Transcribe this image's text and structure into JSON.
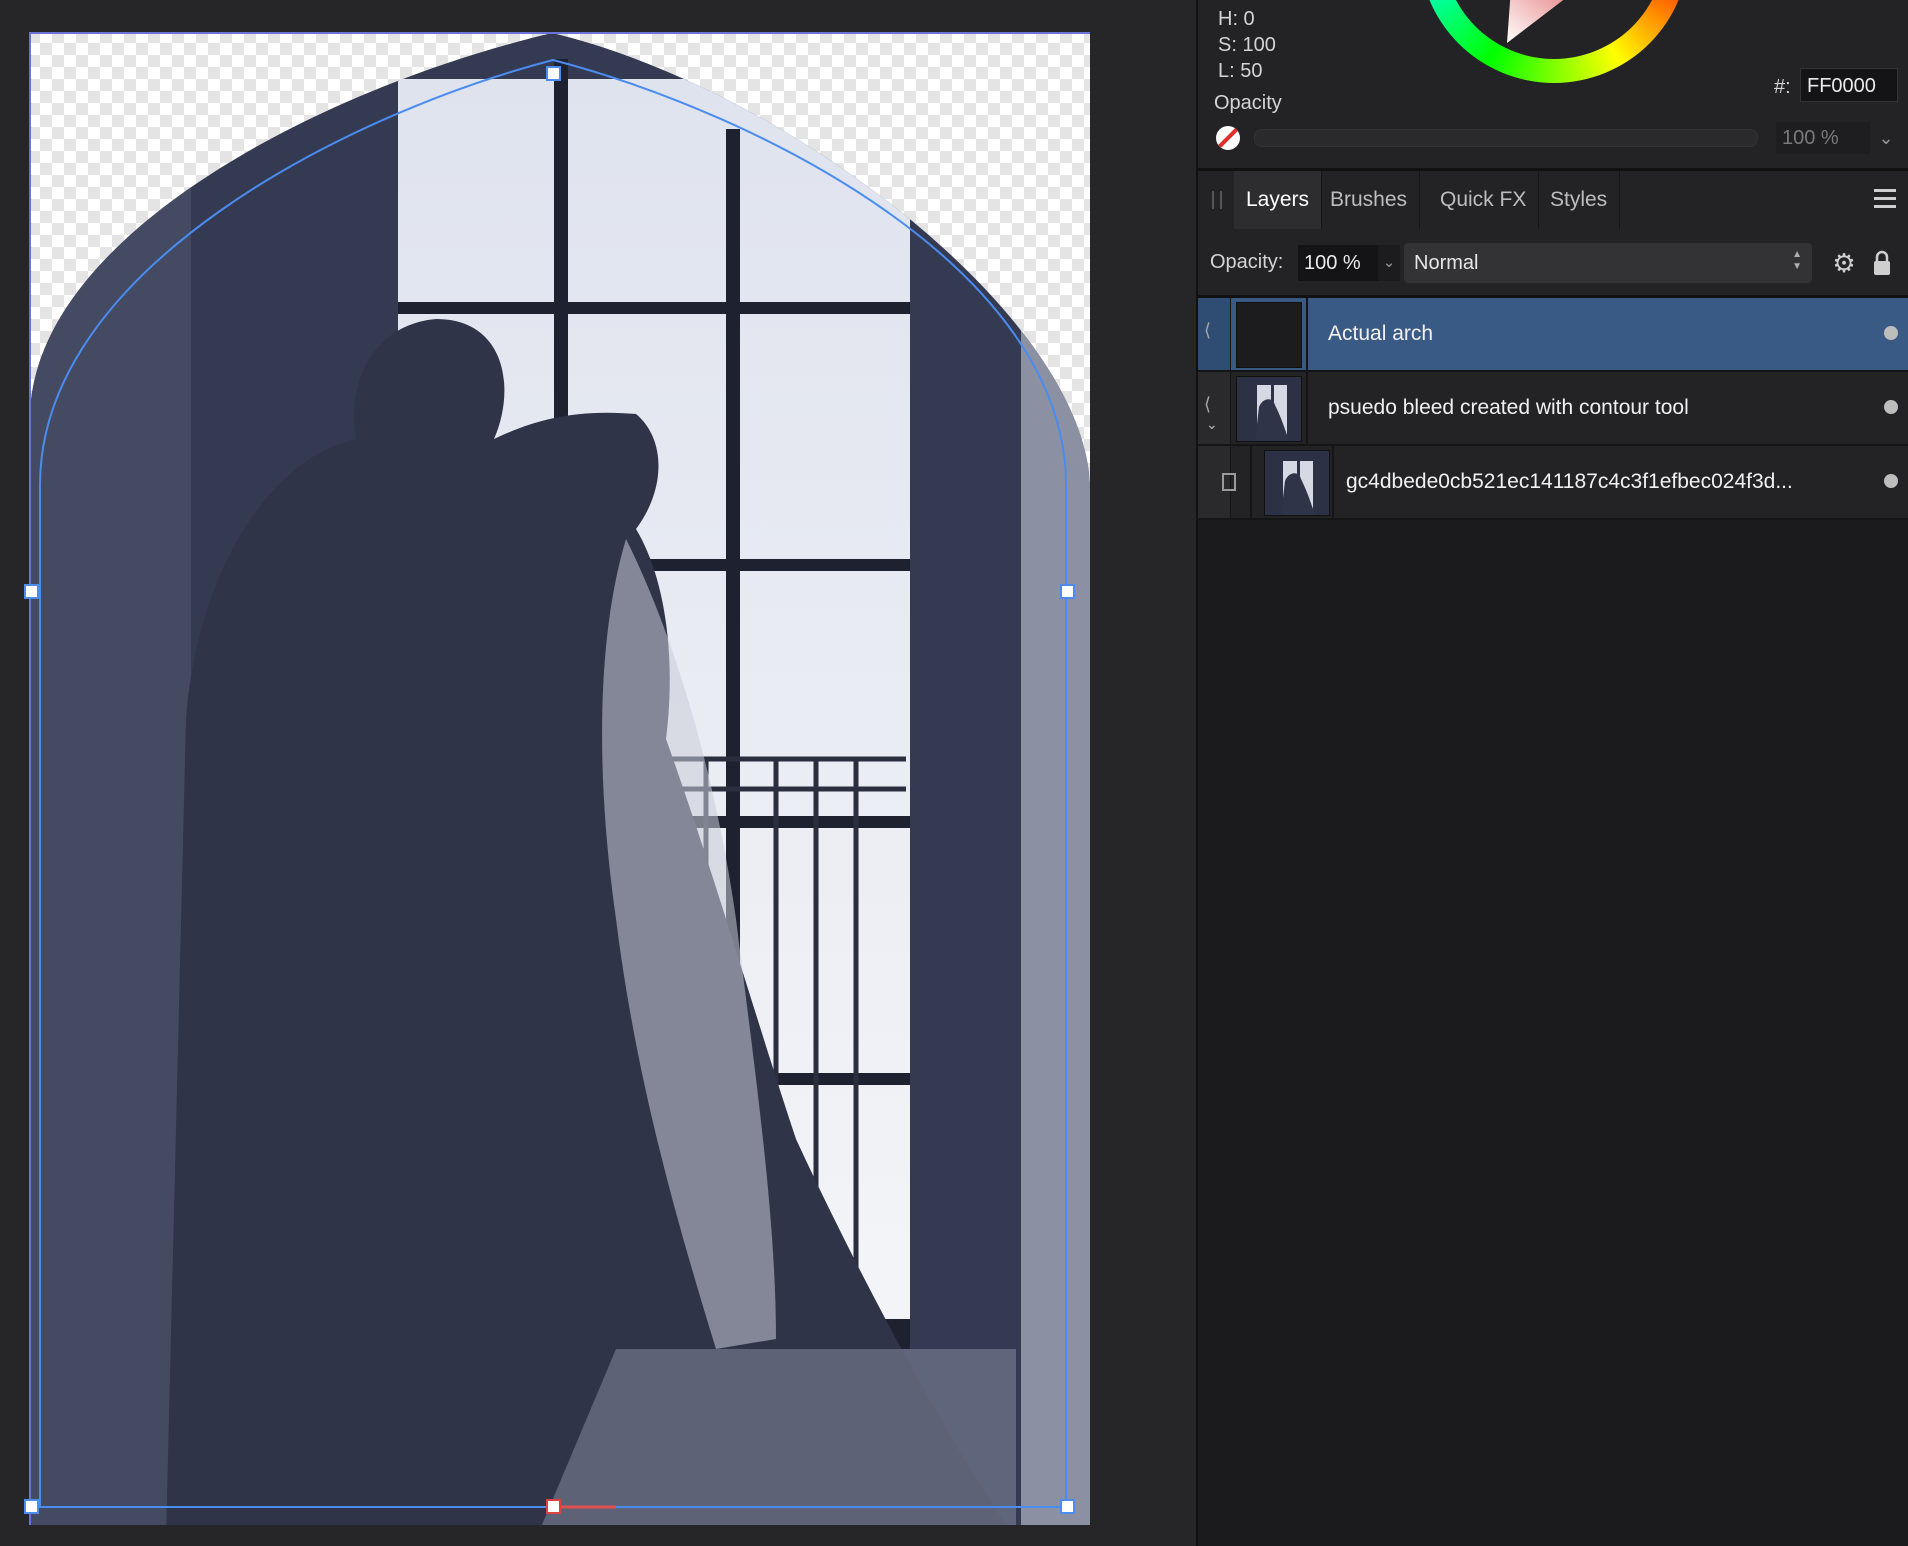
{
  "color_panel": {
    "h": "H: 0",
    "s": "S: 100",
    "l": "L: 50",
    "hex_label": "#:",
    "hex_value": "FF0000",
    "opacity_title": "Opacity",
    "opacity_value": "100 %",
    "wheel_icon": "color-wheel",
    "no_color_icon": "no-color-swatch"
  },
  "tabs": [
    {
      "label": "Layers",
      "active": true
    },
    {
      "label": "Brushes",
      "active": false
    },
    {
      "label": "Quick FX",
      "active": false
    },
    {
      "label": "Styles",
      "active": false
    }
  ],
  "layer_controls": {
    "opacity_label": "Opacity:",
    "opacity_value": "100 %",
    "blend_mode": "Normal"
  },
  "layers": [
    {
      "name": "Actual arch",
      "selected": true
    },
    {
      "name": "psuedo bleed created with contour tool",
      "selected": false
    },
    {
      "name": "gc4dbede0cb521ec141187c4c3f1efbec024f3d...",
      "selected": false
    }
  ],
  "colors": {
    "accent_selected": "#3a5a86",
    "selection_stroke": "#4a8cf0",
    "photo_shadow": "#343a52"
  }
}
